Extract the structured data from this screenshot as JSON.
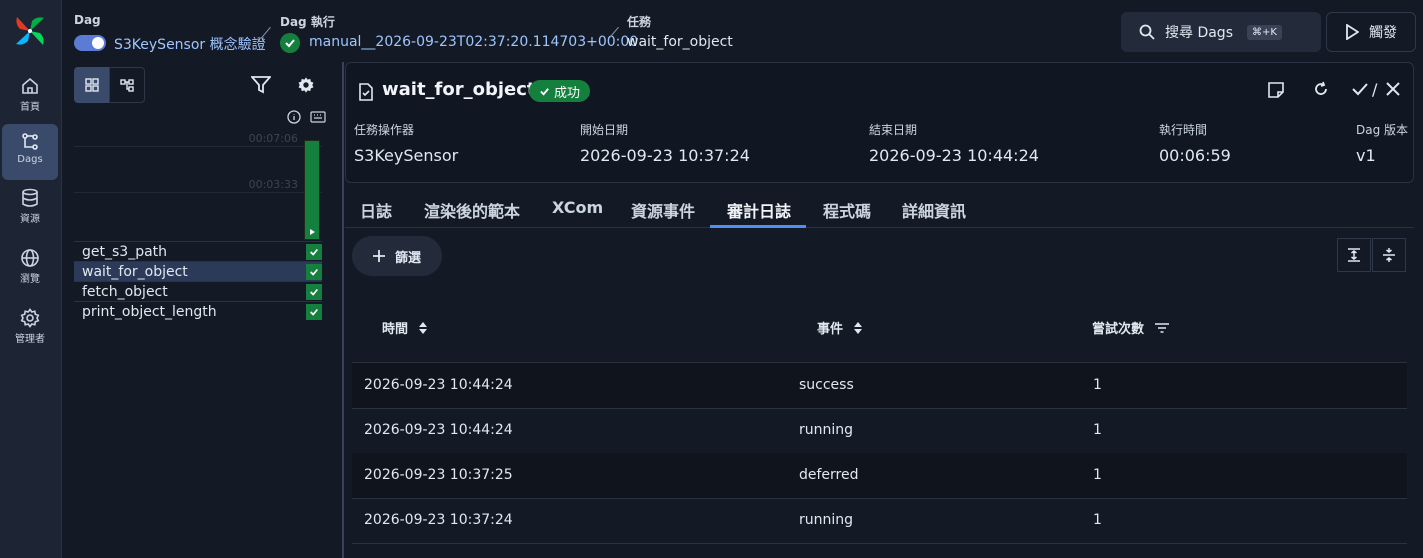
{
  "nav": [
    {
      "label": "首頁",
      "icon": "home-icon"
    },
    {
      "label": "Dags",
      "icon": "dags-icon"
    },
    {
      "label": "資源",
      "icon": "database-icon"
    },
    {
      "label": "瀏覽",
      "icon": "globe-icon"
    },
    {
      "label": "管理者",
      "icon": "gear-icon"
    }
  ],
  "breadcrumb": {
    "dag_label": "Dag",
    "dag_value": "S3KeySensor 概念驗證",
    "run_label": "Dag 執行",
    "run_value": "manual__2026-09-23T02:37:20.114703+00:00",
    "task_label": "任務",
    "task_value": "wait_for_object"
  },
  "header": {
    "search_label": "搜尋 Dags",
    "search_shortcut": "⌘+K",
    "trigger_label": "觸發"
  },
  "grid": {
    "durations": [
      "00:07:06",
      "00:03:33"
    ],
    "tasks": [
      {
        "name": "get_s3_path",
        "selected": false
      },
      {
        "name": "wait_for_object",
        "selected": true
      },
      {
        "name": "fetch_object",
        "selected": false
      },
      {
        "name": "print_object_length",
        "selected": false
      }
    ]
  },
  "task": {
    "title": "wait_for_object",
    "status": "成功",
    "separator": "/",
    "meta": [
      {
        "label": "任務操作器",
        "value": "S3KeySensor"
      },
      {
        "label": "開始日期",
        "value": "2026-09-23 10:37:24"
      },
      {
        "label": "結束日期",
        "value": "2026-09-23 10:44:24"
      },
      {
        "label": "執行時間",
        "value": "00:06:59"
      },
      {
        "label": "Dag 版本",
        "value": "v1"
      }
    ]
  },
  "tabs": [
    "日誌",
    "渲染後的範本",
    "XCom",
    "資源事件",
    "審計日誌",
    "程式碼",
    "詳細資訊"
  ],
  "active_tab": 4,
  "audit": {
    "filter_label": "篩選",
    "columns": [
      "時間",
      "事件",
      "嘗試次數"
    ],
    "rows": [
      [
        "2026-09-23 10:44:24",
        "success",
        "1"
      ],
      [
        "2026-09-23 10:44:24",
        "running",
        "1"
      ],
      [
        "2026-09-23 10:37:25",
        "deferred",
        "1"
      ],
      [
        "2026-09-23 10:37:24",
        "running",
        "1"
      ]
    ]
  },
  "colors": {
    "accent": "#4f8ef7",
    "success": "#15803d",
    "selected_row": "#2b3a58"
  }
}
